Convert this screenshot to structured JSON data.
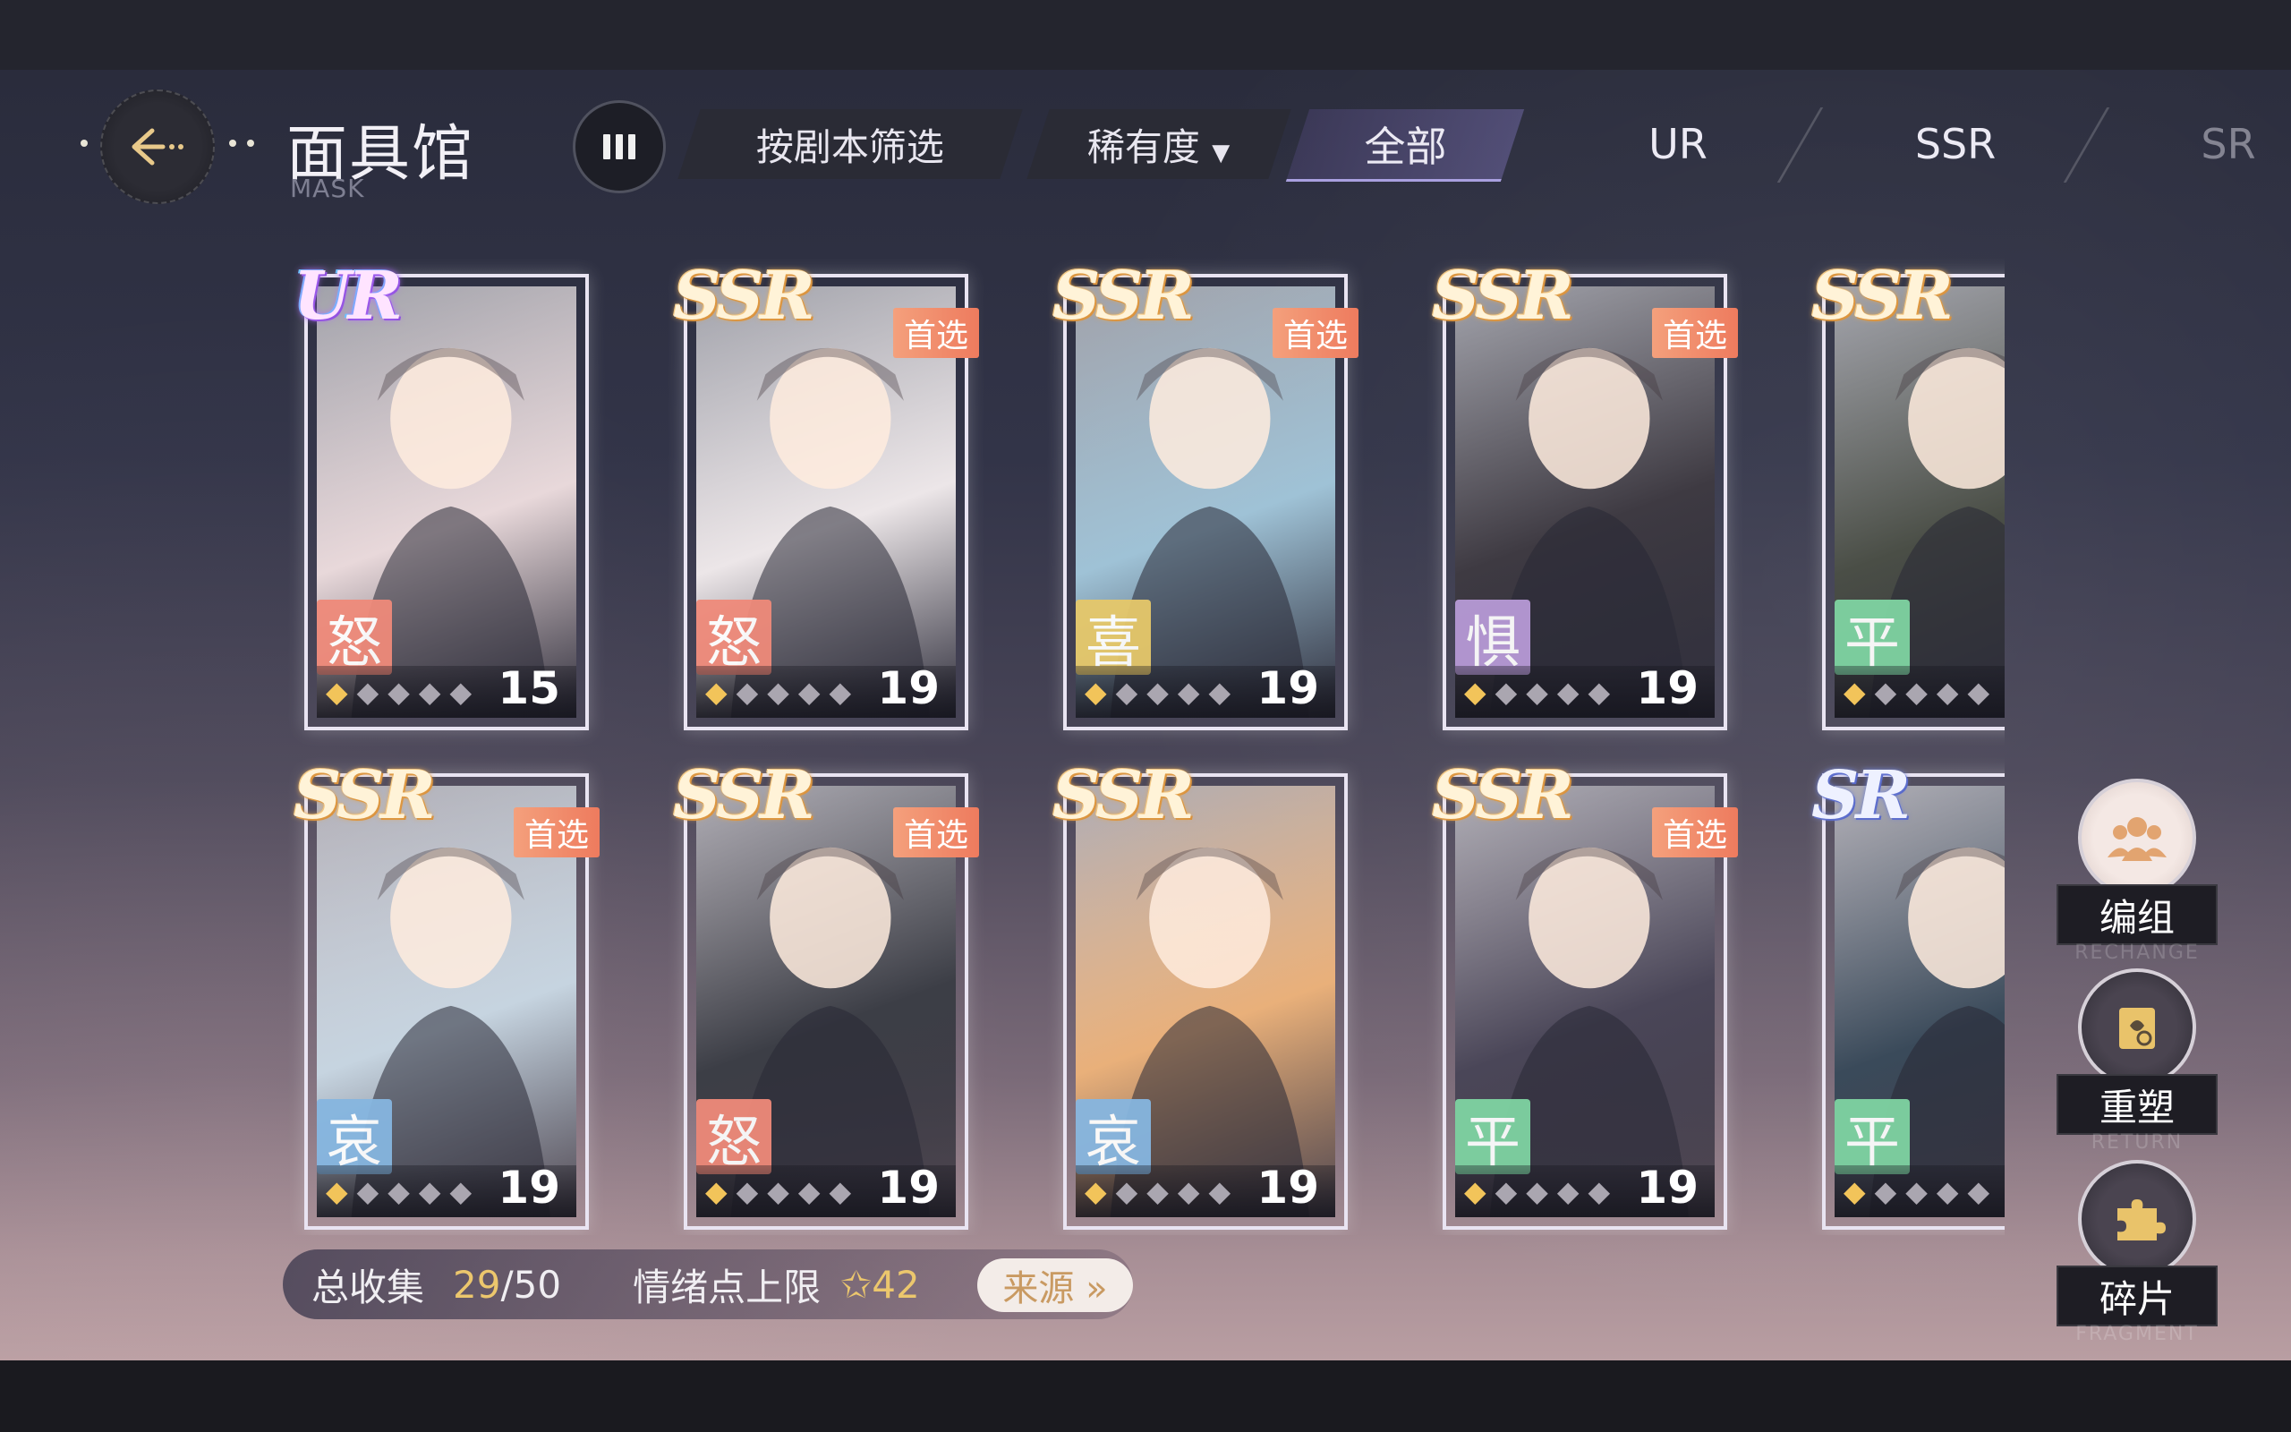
{
  "header": {
    "title": "面具馆",
    "subtitle": "MASK"
  },
  "filters": {
    "script_filter": "按剧本筛选",
    "rarity_filter": "稀有度",
    "tabs": [
      "全部",
      "UR",
      "SSR",
      "SR"
    ],
    "active_tab": "全部"
  },
  "cards": [
    {
      "rarity": "UR",
      "preferred": "",
      "emotion": "怒",
      "stars_on": 1,
      "level": "15",
      "emotion_color": "#ef8a7a",
      "art_color": "#e8d8da"
    },
    {
      "rarity": "SSR",
      "preferred": "首选",
      "emotion": "怒",
      "stars_on": 1,
      "level": "19",
      "emotion_color": "#ef8a7a",
      "art_color": "#ece6e8"
    },
    {
      "rarity": "SSR",
      "preferred": "首选",
      "emotion": "喜",
      "stars_on": 1,
      "level": "19",
      "emotion_color": "#e6c86a",
      "art_color": "#9fc2d6"
    },
    {
      "rarity": "SSR",
      "preferred": "首选",
      "emotion": "惧",
      "stars_on": 1,
      "level": "19",
      "emotion_color": "#b79ad6",
      "art_color": "#3e3a42"
    },
    {
      "rarity": "SSR",
      "preferred": "",
      "emotion": "平",
      "stars_on": 1,
      "level": "",
      "emotion_color": "#7fd4a2",
      "art_color": "#4a4e46"
    },
    {
      "rarity": "SSR",
      "preferred": "首选",
      "emotion": "哀",
      "stars_on": 1,
      "level": "19",
      "emotion_color": "#86b6e0",
      "art_color": "#c6d4e0"
    },
    {
      "rarity": "SSR",
      "preferred": "首选",
      "emotion": "怒",
      "stars_on": 1,
      "level": "19",
      "emotion_color": "#ef8a7a",
      "art_color": "#3c3e46"
    },
    {
      "rarity": "SSR",
      "preferred": "",
      "emotion": "哀",
      "stars_on": 1,
      "level": "19",
      "emotion_color": "#86b6e0",
      "art_color": "#e9b07a"
    },
    {
      "rarity": "SSR",
      "preferred": "首选",
      "emotion": "平",
      "stars_on": 1,
      "level": "19",
      "emotion_color": "#7fd4a2",
      "art_color": "#4a4658"
    },
    {
      "rarity": "SR",
      "preferred": "",
      "emotion": "平",
      "stars_on": 1,
      "level": "",
      "emotion_color": "#7fd4a2",
      "art_color": "#3a4a5a"
    }
  ],
  "collection": {
    "label": "总收集",
    "count": "29",
    "total": "/50",
    "emotion_label": "情绪点上限",
    "emotion_value": "42",
    "source_button": "来源 »"
  },
  "side_buttons": [
    {
      "label": "编组",
      "sub": "RECHANGE",
      "icon": "group-icon"
    },
    {
      "label": "重塑",
      "sub": "RETURN",
      "icon": "reshape-icon"
    },
    {
      "label": "碎片",
      "sub": "FRAGMENT",
      "icon": "puzzle-icon"
    }
  ]
}
